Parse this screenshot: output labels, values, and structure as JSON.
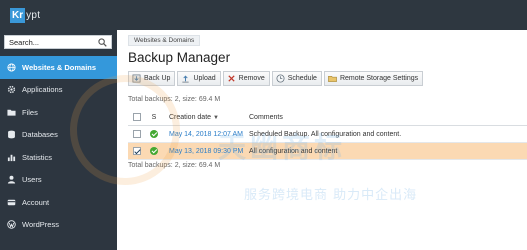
{
  "app": {
    "logo_box": "Kr",
    "logo_rest": "ypt"
  },
  "search": {
    "value": "Search..."
  },
  "sidebar": {
    "items": [
      {
        "label": "Websites & Domains",
        "icon": "globe-icon",
        "active": true
      },
      {
        "label": "Applications",
        "icon": "gear-icon",
        "active": false
      },
      {
        "label": "Files",
        "icon": "folder-icon",
        "active": false
      },
      {
        "label": "Databases",
        "icon": "database-icon",
        "active": false
      },
      {
        "label": "Statistics",
        "icon": "chart-icon",
        "active": false
      },
      {
        "label": "Users",
        "icon": "user-icon",
        "active": false
      },
      {
        "label": "Account",
        "icon": "account-icon",
        "active": false
      },
      {
        "label": "WordPress",
        "icon": "wordpress-icon",
        "active": false
      }
    ]
  },
  "main": {
    "breadcrumb": "Websites & Domains",
    "title": "Backup Manager",
    "toolbar": {
      "back_up": "Back Up",
      "upload": "Upload",
      "remove": "Remove",
      "schedule": "Schedule",
      "remote": "Remote Storage Settings"
    },
    "summary_top": "Total backups: 2, size: 69.4 M",
    "summary_bottom": "Total backups: 2, size: 69.4 M",
    "table": {
      "headers": {
        "status": "S",
        "date": "Creation date",
        "comments": "Comments"
      },
      "rows": [
        {
          "date": "May 14, 2018 12:07 AM",
          "comment": "Scheduled Backup. All configuration and content.",
          "checked": false
        },
        {
          "date": "May 13, 2018 09:30 PM",
          "comment": "All configuration and content",
          "checked": true
        }
      ]
    }
  },
  "watermark": {
    "big": "天幽商标",
    "small": "服务跨境电商  助力中企出海"
  },
  "colors": {
    "topbar": "#2e3740",
    "sidebar": "#2d3640",
    "accent": "#3498db",
    "selected_row": "#fbd9b3",
    "ok_green": "#44a832",
    "link": "#2a7dc8"
  }
}
